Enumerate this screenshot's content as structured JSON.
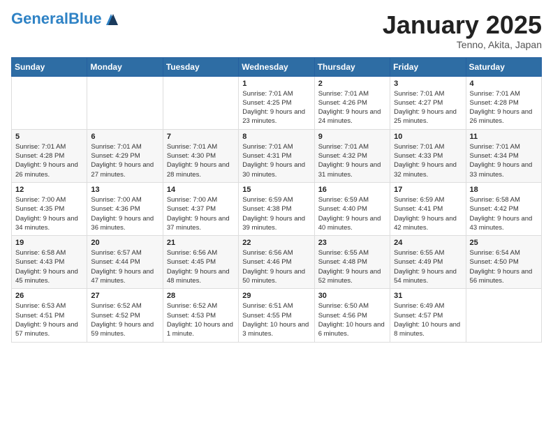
{
  "header": {
    "logo_general": "General",
    "logo_blue": "Blue",
    "month_title": "January 2025",
    "location": "Tenno, Akita, Japan"
  },
  "days_of_week": [
    "Sunday",
    "Monday",
    "Tuesday",
    "Wednesday",
    "Thursday",
    "Friday",
    "Saturday"
  ],
  "weeks": [
    [
      {
        "day": "",
        "info": ""
      },
      {
        "day": "",
        "info": ""
      },
      {
        "day": "",
        "info": ""
      },
      {
        "day": "1",
        "info": "Sunrise: 7:01 AM\nSunset: 4:25 PM\nDaylight: 9 hours and 23 minutes."
      },
      {
        "day": "2",
        "info": "Sunrise: 7:01 AM\nSunset: 4:26 PM\nDaylight: 9 hours and 24 minutes."
      },
      {
        "day": "3",
        "info": "Sunrise: 7:01 AM\nSunset: 4:27 PM\nDaylight: 9 hours and 25 minutes."
      },
      {
        "day": "4",
        "info": "Sunrise: 7:01 AM\nSunset: 4:28 PM\nDaylight: 9 hours and 26 minutes."
      }
    ],
    [
      {
        "day": "5",
        "info": "Sunrise: 7:01 AM\nSunset: 4:28 PM\nDaylight: 9 hours and 26 minutes."
      },
      {
        "day": "6",
        "info": "Sunrise: 7:01 AM\nSunset: 4:29 PM\nDaylight: 9 hours and 27 minutes."
      },
      {
        "day": "7",
        "info": "Sunrise: 7:01 AM\nSunset: 4:30 PM\nDaylight: 9 hours and 28 minutes."
      },
      {
        "day": "8",
        "info": "Sunrise: 7:01 AM\nSunset: 4:31 PM\nDaylight: 9 hours and 30 minutes."
      },
      {
        "day": "9",
        "info": "Sunrise: 7:01 AM\nSunset: 4:32 PM\nDaylight: 9 hours and 31 minutes."
      },
      {
        "day": "10",
        "info": "Sunrise: 7:01 AM\nSunset: 4:33 PM\nDaylight: 9 hours and 32 minutes."
      },
      {
        "day": "11",
        "info": "Sunrise: 7:01 AM\nSunset: 4:34 PM\nDaylight: 9 hours and 33 minutes."
      }
    ],
    [
      {
        "day": "12",
        "info": "Sunrise: 7:00 AM\nSunset: 4:35 PM\nDaylight: 9 hours and 34 minutes."
      },
      {
        "day": "13",
        "info": "Sunrise: 7:00 AM\nSunset: 4:36 PM\nDaylight: 9 hours and 36 minutes."
      },
      {
        "day": "14",
        "info": "Sunrise: 7:00 AM\nSunset: 4:37 PM\nDaylight: 9 hours and 37 minutes."
      },
      {
        "day": "15",
        "info": "Sunrise: 6:59 AM\nSunset: 4:38 PM\nDaylight: 9 hours and 39 minutes."
      },
      {
        "day": "16",
        "info": "Sunrise: 6:59 AM\nSunset: 4:40 PM\nDaylight: 9 hours and 40 minutes."
      },
      {
        "day": "17",
        "info": "Sunrise: 6:59 AM\nSunset: 4:41 PM\nDaylight: 9 hours and 42 minutes."
      },
      {
        "day": "18",
        "info": "Sunrise: 6:58 AM\nSunset: 4:42 PM\nDaylight: 9 hours and 43 minutes."
      }
    ],
    [
      {
        "day": "19",
        "info": "Sunrise: 6:58 AM\nSunset: 4:43 PM\nDaylight: 9 hours and 45 minutes."
      },
      {
        "day": "20",
        "info": "Sunrise: 6:57 AM\nSunset: 4:44 PM\nDaylight: 9 hours and 47 minutes."
      },
      {
        "day": "21",
        "info": "Sunrise: 6:56 AM\nSunset: 4:45 PM\nDaylight: 9 hours and 48 minutes."
      },
      {
        "day": "22",
        "info": "Sunrise: 6:56 AM\nSunset: 4:46 PM\nDaylight: 9 hours and 50 minutes."
      },
      {
        "day": "23",
        "info": "Sunrise: 6:55 AM\nSunset: 4:48 PM\nDaylight: 9 hours and 52 minutes."
      },
      {
        "day": "24",
        "info": "Sunrise: 6:55 AM\nSunset: 4:49 PM\nDaylight: 9 hours and 54 minutes."
      },
      {
        "day": "25",
        "info": "Sunrise: 6:54 AM\nSunset: 4:50 PM\nDaylight: 9 hours and 56 minutes."
      }
    ],
    [
      {
        "day": "26",
        "info": "Sunrise: 6:53 AM\nSunset: 4:51 PM\nDaylight: 9 hours and 57 minutes."
      },
      {
        "day": "27",
        "info": "Sunrise: 6:52 AM\nSunset: 4:52 PM\nDaylight: 9 hours and 59 minutes."
      },
      {
        "day": "28",
        "info": "Sunrise: 6:52 AM\nSunset: 4:53 PM\nDaylight: 10 hours and 1 minute."
      },
      {
        "day": "29",
        "info": "Sunrise: 6:51 AM\nSunset: 4:55 PM\nDaylight: 10 hours and 3 minutes."
      },
      {
        "day": "30",
        "info": "Sunrise: 6:50 AM\nSunset: 4:56 PM\nDaylight: 10 hours and 6 minutes."
      },
      {
        "day": "31",
        "info": "Sunrise: 6:49 AM\nSunset: 4:57 PM\nDaylight: 10 hours and 8 minutes."
      },
      {
        "day": "",
        "info": ""
      }
    ]
  ]
}
